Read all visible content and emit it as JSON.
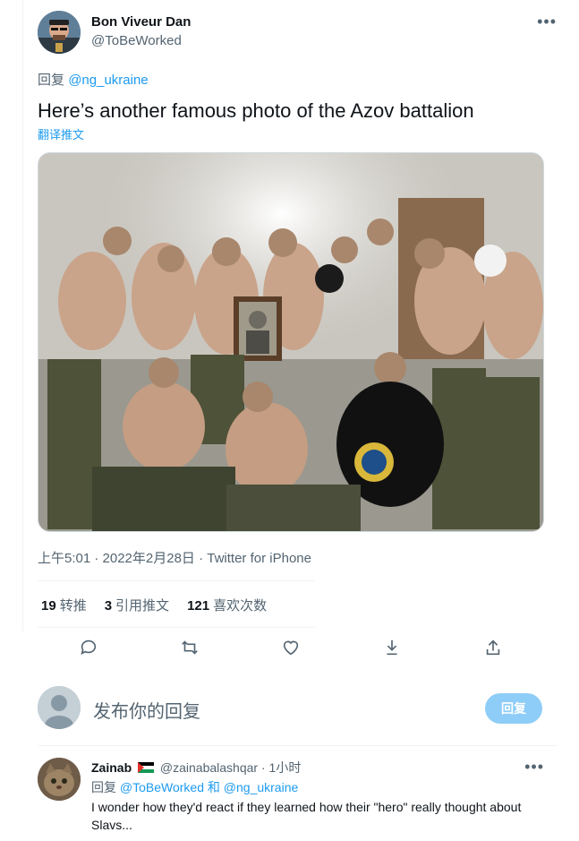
{
  "author": {
    "name": "Bon Viveur Dan",
    "handle": "@ToBeWorked"
  },
  "tweet": {
    "reply_prefix": "回复",
    "reply_to": "@ng_ukraine",
    "text": "Here’s another famous photo of the Azov battalion",
    "translate_label": "翻译推文",
    "timestamp": "上午5:01 · 2022年2月28日 · Twitter for iPhone"
  },
  "stats": {
    "retweets_count": "19",
    "retweets_label": "转推",
    "quotes_count": "3",
    "quotes_label": "引用推文",
    "likes_count": "121",
    "likes_label": "喜欢次数"
  },
  "actions": [
    "reply-icon",
    "retweet-icon",
    "like-icon",
    "bookmark-icon",
    "share-icon"
  ],
  "compose": {
    "placeholder": "发布你的回复",
    "button_label": "回复"
  },
  "reply": {
    "name": "Zainab",
    "handle": "@zainabalashqar",
    "time": "1小时",
    "reply_prefix": "回复",
    "reply_to_1": "@ToBeWorked",
    "and": "和",
    "reply_to_2": "@ng_ukraine",
    "text": "I wonder how they'd react if they learned how their \"hero\" really thought about Slavs..."
  },
  "colors": {
    "accent": "#1d9bf0",
    "secondary_text": "#536471",
    "reply_button_disabled": "#8ecdf7"
  }
}
